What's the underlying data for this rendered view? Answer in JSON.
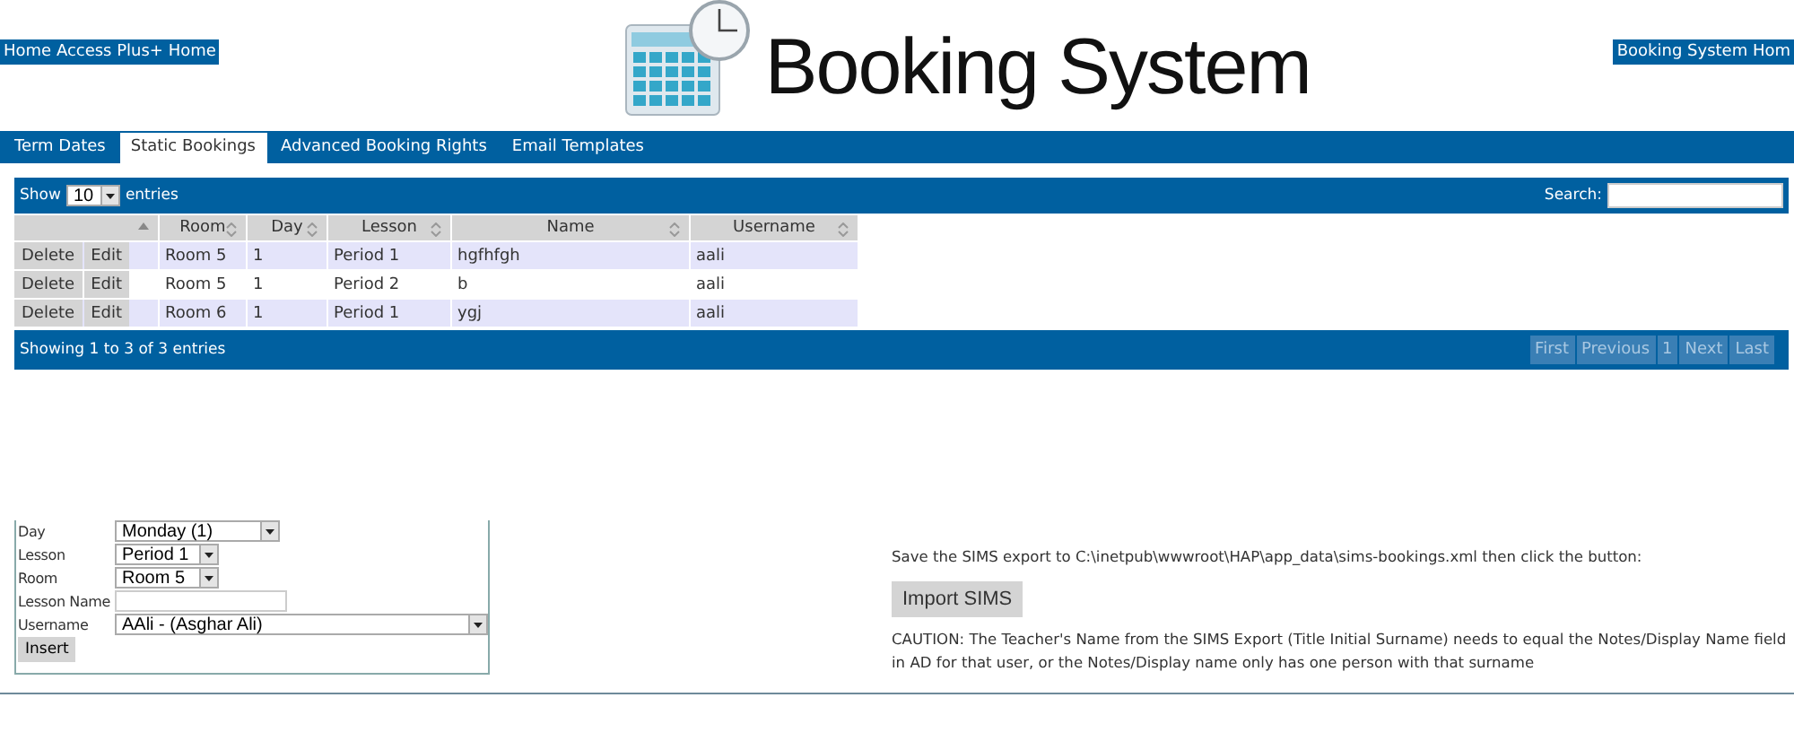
{
  "header": {
    "left_link": "Home Access Plus+ Home",
    "title": "Booking System",
    "right_link": "Booking System Hom"
  },
  "tabs": [
    {
      "label": "Term Dates",
      "selected": false
    },
    {
      "label": "Static Bookings",
      "selected": true
    },
    {
      "label": "Advanced Booking Rights",
      "selected": false
    },
    {
      "label": "Email Templates",
      "selected": false
    }
  ],
  "table": {
    "show_label": "Show",
    "length": "10",
    "entries_label": "entries",
    "search_label": "Search:",
    "action_column": {
      "sorted": true
    },
    "columns": [
      {
        "label": "Room",
        "sorted": false
      },
      {
        "label": "Day",
        "sorted": false
      },
      {
        "label": "Lesson",
        "sorted": false
      },
      {
        "label": "Name",
        "sorted": false
      },
      {
        "label": "Username",
        "sorted": false
      }
    ],
    "rows": [
      {
        "actions": [
          "Delete",
          "Edit"
        ],
        "cells": [
          "Room 5",
          "1",
          "Period 1",
          "hgfhfgh",
          "aali"
        ]
      },
      {
        "actions": [
          "Delete",
          "Edit"
        ],
        "cells": [
          "Room 5",
          "1",
          "Period 2",
          "b",
          "aali"
        ]
      },
      {
        "actions": [
          "Delete",
          "Edit"
        ],
        "cells": [
          "Room 6",
          "1",
          "Period 1",
          "ygj",
          "aali"
        ]
      }
    ],
    "info": "Showing 1 to 3 of 3 entries",
    "pagination": [
      {
        "label": "First",
        "disabled": true
      },
      {
        "label": "Previous",
        "disabled": true
      },
      {
        "label": "1",
        "disabled": true
      },
      {
        "label": "Next",
        "disabled": true
      },
      {
        "label": "Last",
        "disabled": true
      }
    ]
  },
  "form": {
    "fields": [
      {
        "label": "Day",
        "kind": "select",
        "value": "Monday (1)"
      },
      {
        "label": "Lesson",
        "kind": "select",
        "value": "Period 1"
      },
      {
        "label": "Room",
        "kind": "select",
        "value": "Room 5"
      },
      {
        "label": "Lesson Name",
        "kind": "text"
      },
      {
        "label": "Username",
        "kind": "select",
        "value": "AAli - (Asghar Ali)"
      }
    ],
    "button": "Insert"
  },
  "sims": {
    "instruction": "Save the SIMS export to C:\\inetpub\\wwwroot\\HAP\\app_data\\sims-bookings.xml then click the button:",
    "button": "Import SIMS",
    "caution": "CAUTION: The Teacher's Name from the SIMS Export (Title Initial Surname) needs to equal the Notes/Display Name field in AD for that user, or the Notes/Display name only has one person with that surname"
  }
}
